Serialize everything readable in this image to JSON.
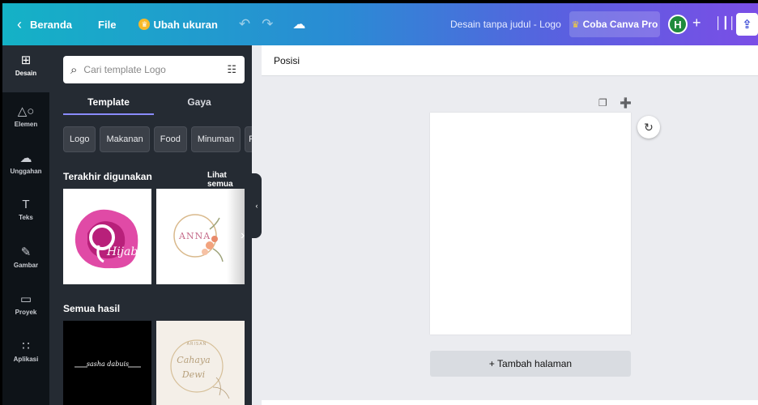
{
  "topbar": {
    "back_icon": "chevron-left-icon",
    "home_label": "Beranda",
    "file_label": "File",
    "resize_label": "Ubah ukuran",
    "doc_title": "Desain tanpa judul - Logo",
    "pro_label": "Coba Canva Pro",
    "avatar_initial": "H",
    "plus_symbol": "+",
    "gradient_colors": [
      "#14b2c6",
      "#7a4ee6"
    ]
  },
  "rail": {
    "items": [
      {
        "label": "Desain",
        "icon": "layout-icon"
      },
      {
        "label": "Elemen",
        "icon": "shapes-icon"
      },
      {
        "label": "Unggahan",
        "icon": "cloud-upload-icon"
      },
      {
        "label": "Teks",
        "icon": "text-icon"
      },
      {
        "label": "Gambar",
        "icon": "draw-icon"
      },
      {
        "label": "Proyek",
        "icon": "folder-icon"
      },
      {
        "label": "Aplikasi",
        "icon": "apps-grid-icon"
      }
    ]
  },
  "panel": {
    "search_placeholder": "Cari template Logo",
    "tabs": [
      {
        "label": "Template",
        "active": true
      },
      {
        "label": "Gaya",
        "active": false
      }
    ],
    "chips": [
      "Logo",
      "Makanan",
      "Food",
      "Minuman",
      "F"
    ],
    "recent_title": "Terakhir digunakan",
    "see_all": "Lihat semua",
    "all_results_title": "Semua hasil",
    "thumbs": {
      "hijab_text": "Hijab",
      "anna_text": "ANNA",
      "sasha_text": "sasha dabuis",
      "arisan_top": "ARISAN",
      "arisan_name1": "Cahaya",
      "arisan_name2": "Dewi"
    }
  },
  "canvas": {
    "toolbar_label": "Posisi",
    "add_page_label": "+ Tambah halaman"
  }
}
